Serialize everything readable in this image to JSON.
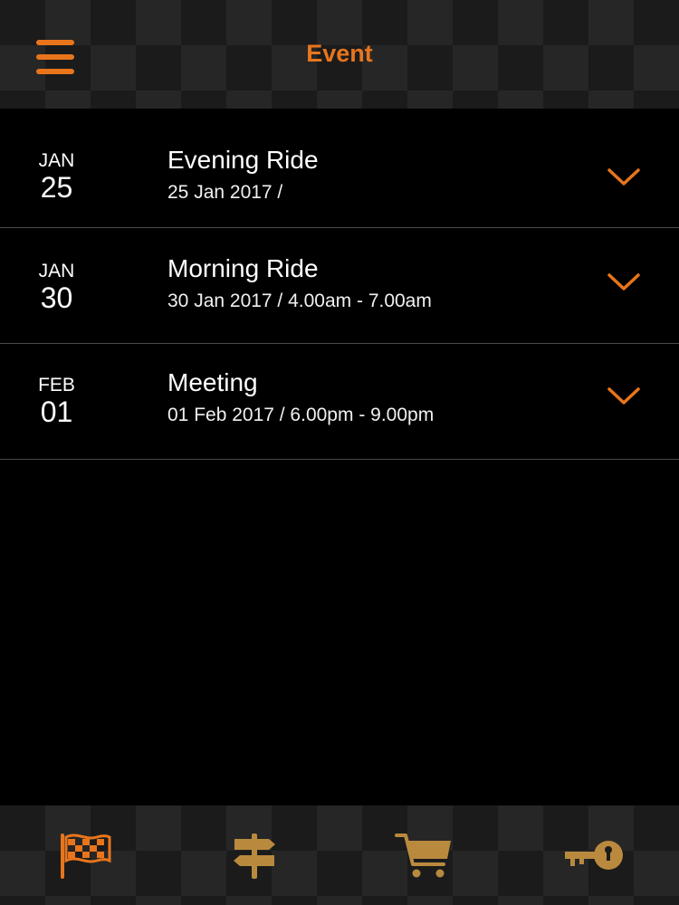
{
  "header": {
    "title": "Event",
    "menu_icon": "hamburger-menu-icon"
  },
  "events": [
    {
      "month": "JAN",
      "day": "25",
      "title": "Evening Ride",
      "subtitle": "25 Jan 2017 /"
    },
    {
      "month": "JAN",
      "day": "30",
      "title": "Morning Ride",
      "subtitle": "30 Jan 2017 /  4.00am - 7.00am"
    },
    {
      "month": "FEB",
      "day": "01",
      "title": "Meeting",
      "subtitle": "01 Feb 2017 /  6.00pm - 9.00pm"
    }
  ],
  "tabbar": {
    "tabs": [
      {
        "icon": "checkered-flag-icon",
        "active": true
      },
      {
        "icon": "signpost-icon",
        "active": false
      },
      {
        "icon": "shopping-cart-icon",
        "active": false
      },
      {
        "icon": "key-icon",
        "active": false
      }
    ]
  },
  "colors": {
    "accent": "#e8751c",
    "tab_inactive": "#b98a3e",
    "background": "#000000",
    "divider": "#4a4a4a"
  }
}
